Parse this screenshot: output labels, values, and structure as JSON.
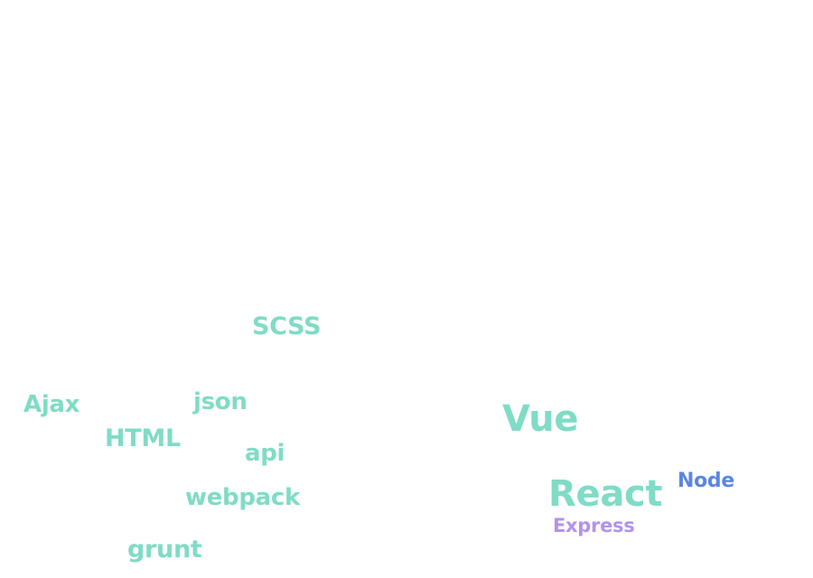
{
  "colors": {
    "teal": "#7fdcc6",
    "blue": "#5b86e0",
    "purple": "#b193ec",
    "background": "#ffffff"
  },
  "word_cloud": {
    "tags": [
      {
        "text": "SCSS",
        "color": "teal"
      },
      {
        "text": "Ajax",
        "color": "teal"
      },
      {
        "text": "json",
        "color": "teal"
      },
      {
        "text": "Vue",
        "color": "teal"
      },
      {
        "text": "HTML",
        "color": "teal"
      },
      {
        "text": "api",
        "color": "teal"
      },
      {
        "text": "Node",
        "color": "blue"
      },
      {
        "text": "React",
        "color": "teal"
      },
      {
        "text": "webpack",
        "color": "teal"
      },
      {
        "text": "Express",
        "color": "purple"
      },
      {
        "text": "grunt",
        "color": "teal"
      }
    ]
  }
}
